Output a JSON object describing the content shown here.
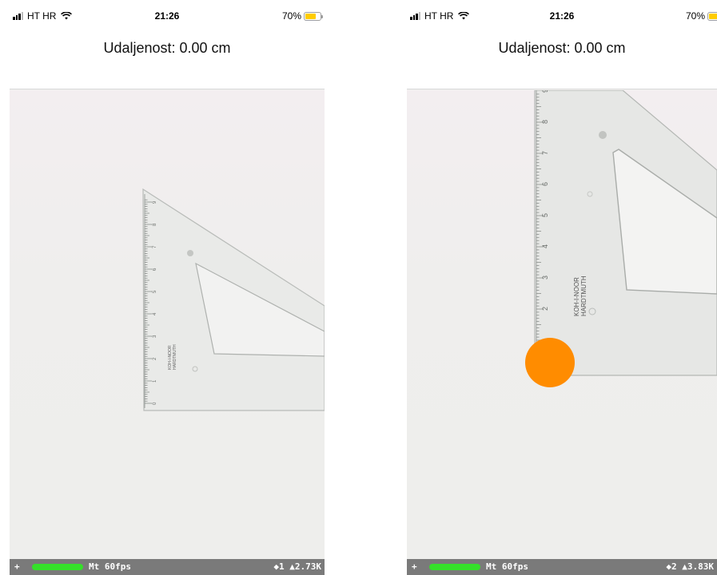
{
  "screens": [
    {
      "status_bar": {
        "carrier": "HT HR",
        "time": "21:26",
        "battery": "70%",
        "battery_level": 0.7
      },
      "distance_text": "Udaljenost: 0.00 cm",
      "debug_bar": {
        "plus": "+",
        "fps": "Mt 60fps",
        "stats": "◆1 ▲2.73K"
      },
      "ruler_numbers": [
        "0",
        "1",
        "2",
        "3",
        "4",
        "5",
        "6",
        "7",
        "8",
        "9"
      ],
      "ruler_brand": [
        "KOH-I-NOOR",
        "HARDTMUTH"
      ],
      "has_marker": false
    },
    {
      "status_bar": {
        "carrier": "HT HR",
        "time": "21:26",
        "battery": "70%",
        "battery_level": 0.7
      },
      "distance_text": "Udaljenost: 0.00 cm",
      "debug_bar": {
        "plus": "+",
        "fps": "Mt 60fps",
        "stats": "◆2 ▲3.83K"
      },
      "ruler_numbers": [
        "1",
        "2",
        "3",
        "4",
        "5",
        "6",
        "7",
        "8",
        "9"
      ],
      "ruler_brand": [
        "KOH-I-NOOR",
        "HARDTMUTH"
      ],
      "has_marker": true,
      "marker_color": "#ff8c00"
    }
  ],
  "colors": {
    "accent_marker": "#ff8c00",
    "debug_meter": "#35e02a",
    "battery": "#ffcc00",
    "debug_bg": "#7a7a7a"
  }
}
